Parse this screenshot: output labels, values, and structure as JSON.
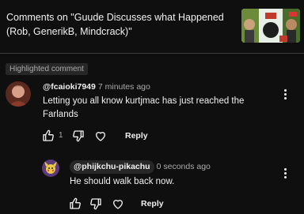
{
  "header": {
    "title": "Comments on \"Guude Discusses what Happened (Rob, GenerikB, Mindcrack)\""
  },
  "highlight_badge": "Highlighted comment",
  "comment": {
    "author": "@fcaioki7949",
    "time": "7 minutes ago",
    "text": "Letting you all know kurtjmac has just reached the Farlands",
    "like_count": "1",
    "reply_label": "Reply"
  },
  "reply": {
    "author": "@phijkchu-pikachu",
    "time": "0 seconds ago",
    "text": "He should walk back now.",
    "reply_label": "Reply"
  },
  "icons": {
    "like": "thumbs-up-icon",
    "dislike": "thumbs-down-icon",
    "heart": "heart-icon",
    "more": "more-vert-icon"
  },
  "colors": {
    "background": "#0f0f0f",
    "text": "#f1f1f1",
    "secondary_text": "#aaaaaa",
    "chip": "#272727"
  }
}
